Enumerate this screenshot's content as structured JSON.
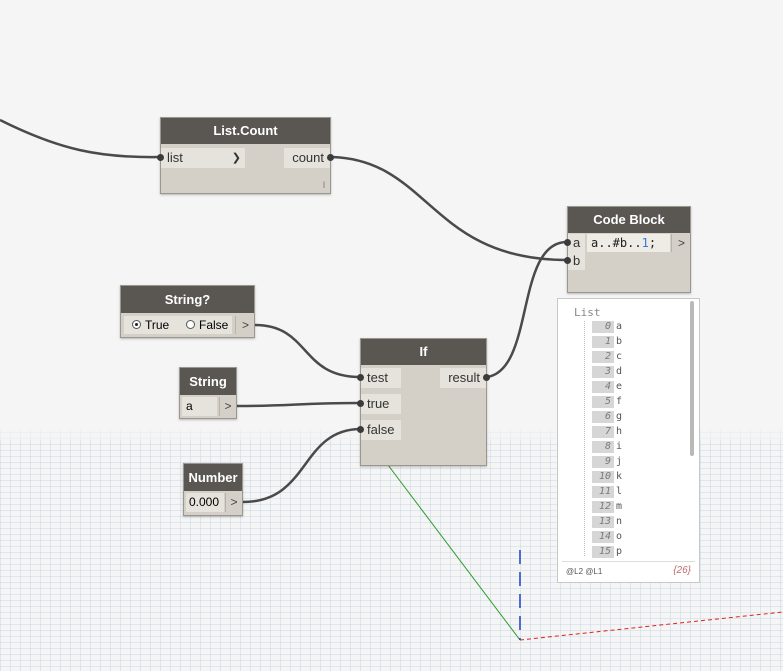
{
  "nodes": {
    "list_count": {
      "title": "List.Count",
      "input": "list",
      "output": "count",
      "lacing": "l"
    },
    "code_block": {
      "title": "Code Block",
      "in_a": "a",
      "in_b": "b",
      "code_part1": "a..#b..",
      "code_num": "1",
      "code_part2": ";"
    },
    "string_q": {
      "title": "String?",
      "opt_true": "True",
      "opt_false": "False"
    },
    "if_node": {
      "title": "If",
      "in_test": "test",
      "in_true": "true",
      "in_false": "false",
      "output": "result"
    },
    "string_node": {
      "title": "String",
      "value": "a"
    },
    "number_node": {
      "title": "Number",
      "value": "0.000"
    }
  },
  "watch": {
    "header": "List",
    "items": [
      {
        "index": "0",
        "value": "a"
      },
      {
        "index": "1",
        "value": "b"
      },
      {
        "index": "2",
        "value": "c"
      },
      {
        "index": "3",
        "value": "d"
      },
      {
        "index": "4",
        "value": "e"
      },
      {
        "index": "5",
        "value": "f"
      },
      {
        "index": "6",
        "value": "g"
      },
      {
        "index": "7",
        "value": "h"
      },
      {
        "index": "8",
        "value": "i"
      },
      {
        "index": "9",
        "value": "j"
      },
      {
        "index": "10",
        "value": "k"
      },
      {
        "index": "11",
        "value": "l"
      },
      {
        "index": "12",
        "value": "m"
      },
      {
        "index": "13",
        "value": "n"
      },
      {
        "index": "14",
        "value": "o"
      },
      {
        "index": "15",
        "value": "p"
      }
    ],
    "levels": "@L2 @L1",
    "count": "{26}"
  },
  "ui": {
    "arrow": ">",
    "chevron": "❯"
  }
}
